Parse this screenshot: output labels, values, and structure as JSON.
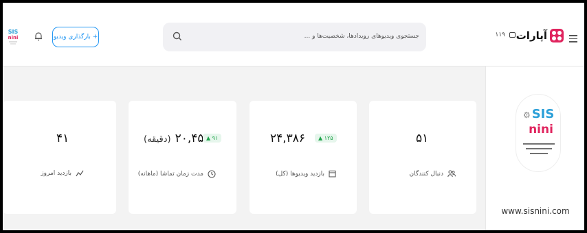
{
  "header": {
    "logo_text": "آپارات",
    "tv_count": "۱۱۹",
    "search_placeholder": "جستجوی ویدیوهای رویدادها، شخصیت‌ها و ...",
    "upload_label": "+ بارگذاری ویدیو"
  },
  "profile": {
    "url": "www.sisnini.com",
    "logo_title": "SIS nini",
    "logo_subtitle": "پخش لوازم بهداشتی و آرایشی مادر و کودک"
  },
  "stats": [
    {
      "id": "followers",
      "value": "۵۱",
      "change": "",
      "label": "دنبال کنندگان",
      "icon": "users-icon"
    },
    {
      "id": "total_views",
      "value": "۲۴,۳۸۶",
      "change": "۱۲۵ ▲",
      "label": "بازدید ویدیوها (کل)",
      "icon": "calendar-icon"
    },
    {
      "id": "watch_time",
      "value": "۲۰,۴۵۶",
      "unit": "(دقیقه)",
      "change": "۹۱ ▲",
      "label": "مدت زمان تماشا (ماهانه)",
      "icon": "clock-icon"
    },
    {
      "id": "today_views",
      "value": "۴۱",
      "change": "",
      "label": "بازدید امروز",
      "icon": "trend-icon"
    }
  ],
  "colors": {
    "accent": "#2196f3",
    "brand": "#e0245e",
    "positive": "#1fa34a"
  }
}
